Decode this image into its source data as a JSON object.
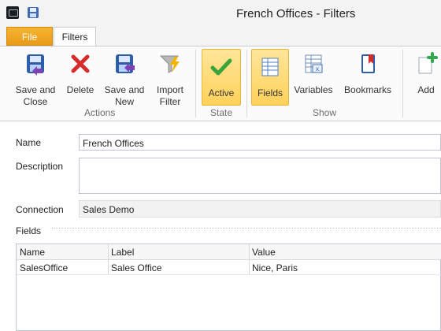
{
  "window": {
    "title": "French Offices - Filters"
  },
  "tabs": {
    "file": "File",
    "filters": "Filters"
  },
  "ribbon": {
    "groups": {
      "actions": "Actions",
      "state": "State",
      "show": "Show"
    },
    "buttons": {
      "save_and_close": "Save and\nClose",
      "delete": "Delete",
      "save_and_new": "Save and\nNew",
      "import_filter": "Import\nFilter",
      "active": "Active",
      "fields": "Fields",
      "variables": "Variables",
      "bookmarks": "Bookmarks",
      "add": "Add"
    },
    "selected": [
      "active",
      "fields"
    ],
    "accent": "#ffd15a"
  },
  "form": {
    "labels": {
      "name": "Name",
      "description": "Description",
      "connection": "Connection",
      "fields": "Fields"
    },
    "values": {
      "name": "French Offices",
      "description": "",
      "connection": "Sales Demo"
    }
  },
  "fields_table": {
    "columns": [
      "Name",
      "Label",
      "Value"
    ],
    "rows": [
      [
        "SalesOffice",
        "Sales Office",
        "Nice, Paris"
      ]
    ]
  },
  "icons": {
    "app": "app-icon",
    "quick_save": "save-icon",
    "save_and_close": "save-close-icon",
    "delete": "delete-x-icon",
    "save_and_new": "save-new-icon",
    "import_filter": "funnel-lightning-icon",
    "active": "checkmark-icon",
    "fields": "table-grid-icon",
    "variables": "variables-grid-icon",
    "bookmarks": "bookmark-book-icon",
    "add": "add-plus-icon"
  },
  "colors": {
    "file_tab": "#f0a21e",
    "active_highlight": "#ffd15a",
    "delete_red": "#d62b2b",
    "check_green": "#3aa53a"
  }
}
